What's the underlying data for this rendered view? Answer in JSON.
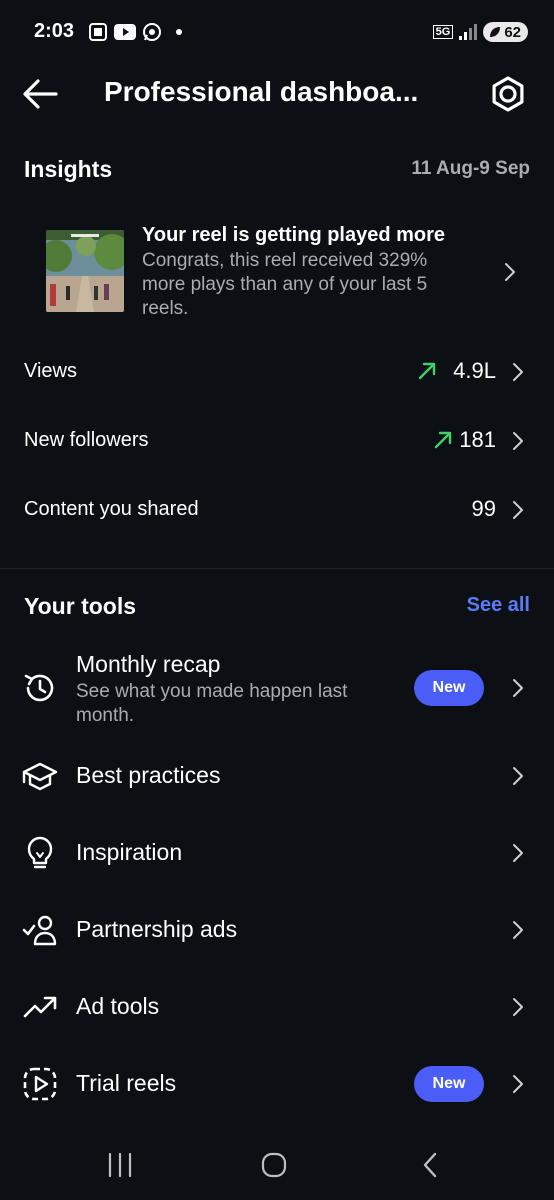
{
  "status_bar": {
    "time": "2:03",
    "battery": "62",
    "network": "5G"
  },
  "header": {
    "title": "Professional dashboa...",
    "back_icon": "arrow-left-icon",
    "settings_icon": "gear-icon"
  },
  "insights": {
    "title": "Insights",
    "date_range": "11 Aug-9 Sep",
    "reel_card": {
      "title": "Your reel is getting played more",
      "description": "Congrats, this reel received 329% more plays than any of your last 5 reels."
    },
    "metrics": [
      {
        "label": "Views",
        "value": "4.9L",
        "trend": "up"
      },
      {
        "label": "New followers",
        "value": "181",
        "trend": "up"
      },
      {
        "label": "Content you shared",
        "value": "99",
        "trend": ""
      }
    ]
  },
  "tools": {
    "title": "Your tools",
    "see_all": "See all",
    "items": [
      {
        "label": "Monthly recap",
        "subtitle": "See what you made happen last month.",
        "badge": "New",
        "icon": "history-clock-icon"
      },
      {
        "label": "Best practices",
        "subtitle": "",
        "badge": "",
        "icon": "graduation-cap-icon"
      },
      {
        "label": "Inspiration",
        "subtitle": "",
        "badge": "",
        "icon": "lightbulb-icon"
      },
      {
        "label": "Partnership ads",
        "subtitle": "",
        "badge": "",
        "icon": "person-check-icon"
      },
      {
        "label": "Ad tools",
        "subtitle": "",
        "badge": "",
        "icon": "trending-up-icon"
      },
      {
        "label": "Trial reels",
        "subtitle": "",
        "badge": "New",
        "icon": "dashed-play-icon"
      }
    ]
  },
  "colors": {
    "background": "#0c0f14",
    "accent": "#4a5df7",
    "link": "#5b7cf7",
    "trend_up": "#3fd26a",
    "secondary_text": "#a8acb3"
  }
}
